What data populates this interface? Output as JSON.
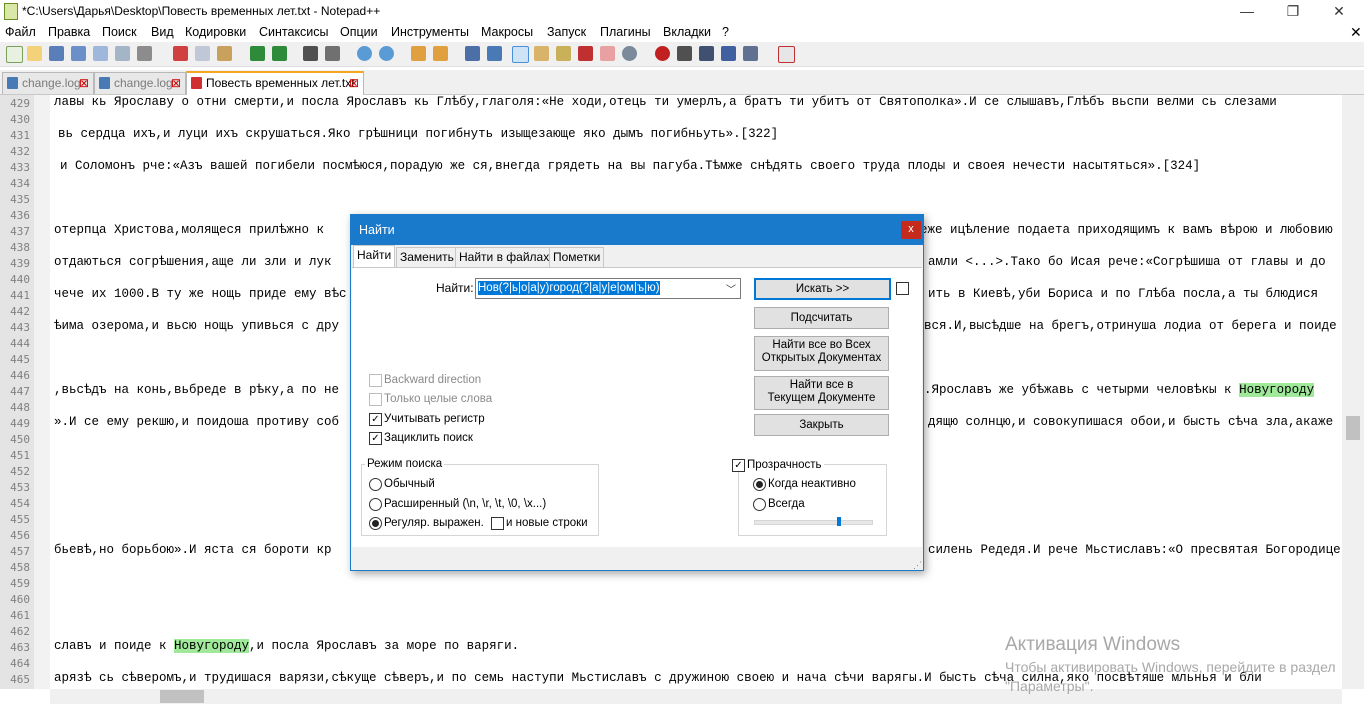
{
  "window": {
    "title": "*C:\\Users\\Дарья\\Desktop\\Повесть временных лет.txt - Notepad++",
    "minimize": "—",
    "maximize": "❐",
    "close": "✕"
  },
  "menu": {
    "items": [
      "Файл",
      "Правка",
      "Поиск",
      "Вид",
      "Кодировки",
      "Синтаксисы",
      "Опции",
      "Инструменты",
      "Макросы",
      "Запуск",
      "Плагины",
      "Вкладки",
      "?"
    ],
    "close": "✕"
  },
  "tabs": [
    {
      "label": "change.log",
      "active": false
    },
    {
      "label": "change.log",
      "active": false
    },
    {
      "label": "Повесть временных лет.txt",
      "active": true
    }
  ],
  "editor": {
    "line_numbers": [
      "429",
      "430",
      "431",
      "432",
      "433",
      "434",
      "435",
      "436",
      "437",
      "438",
      "439",
      "440",
      "441",
      "442",
      "443",
      "444",
      "445",
      "446",
      "447",
      "448",
      "449",
      "450",
      "451",
      "452",
      "453",
      "454",
      "455",
      "456",
      "457",
      "458",
      "459",
      "460",
      "461",
      "462",
      "463",
      "464",
      "465"
    ],
    "lines": [
      {
        "n": "429",
        "text": "лавы кь Ярославу о отни смерти,и посла Ярославъ кь Глѣбу,глаголя:«Не ходи,отець ти умерлъ,а братъ ти убитъ от Святополка».И се слышавъ,Глѣбъ вьспи велми сь слезами"
      },
      {
        "n": "431",
        "text": "вь сердца ихъ,и луци ихъ скрушаться.Яко грѣшници погибнуть изыщезающе яко дымъ погибньуть».[322]"
      },
      {
        "n": "433",
        "text": "и Соломонъ рче:«Азъ вашей погибели посмѣюся,порадую же ся,внегда грядеть на вы пагуба.Тѣмже снѣдять своего труда плоды и своея нечести насытяться».[324]"
      },
      {
        "n": "437",
        "text": "отерпца Христова,молящеся прилѣжно к"
      },
      {
        "n": "437b",
        "text": "еже ицѣление подаета приходящимъ к вамъ вѣрою и любовию"
      },
      {
        "n": "439",
        "text": "отдаються согрѣшения,аще ли зли и лук"
      },
      {
        "n": "439b",
        "text": "амли <...>.Тако бо Исая рече:«Согрѣшиша от главы и до"
      },
      {
        "n": "441",
        "text": "чече их 1000.В ту же нощь приде ему вѣс"
      },
      {
        "n": "441b",
        "text": "ить в Киевѣ,уби Бориса и по Глѣба посла,а ты блюдися"
      },
      {
        "n": "443",
        "text": "ѣима озерома,и вьсю нощь упивься с дру"
      },
      {
        "n": "443b",
        "text": "вся.И,высѣдше на брегъ,отринуша лодиа от берега и поиде"
      },
      {
        "n": "447",
        "text": ",вьсѣдъ на конь,вьбреде в рѣку,а по не"
      },
      {
        "n": "447b",
        "text": ".Ярославъ же убѣжавь с четырми человѣкы к ",
        "hl": "Новугороду"
      },
      {
        "n": "449",
        "text": "».И се ему рекшю,и поидоша противу соб"
      },
      {
        "n": "449b",
        "text": "дящю солнцю,и совокупишася обои,и бысть сѣча зла,акаже"
      },
      {
        "n": "457",
        "text": "бьевѣ,но борьбою».И яста ся бороти кр"
      },
      {
        "n": "457b",
        "text": "силень Редедя.И рече Мьстиславъ:«О пресвятая Богородице"
      },
      {
        "n": "463",
        "text": "славъ и поиде к ",
        "hl": "Новугороду",
        "after": ",и посла Ярославъ за море по варяги."
      },
      {
        "n": "465",
        "text": "арязѣ сь сѣверомъ,и трудишася варязи,сѣкуще сѣверъ,и по семь наступи Мьстиславъ с дружиною своею и нача сѣчи варягы.И бысть сѣча силна,яко посвѣтяше мльнья и бли"
      }
    ]
  },
  "watermark": {
    "title": "Активация Windows",
    "text": "Чтобы активировать Windows, перейдите в раздел \"Параметры\"."
  },
  "dialog": {
    "title": "Найти",
    "close": "x",
    "tabs": [
      "Найти",
      "Заменить",
      "Найти в файлах",
      "Пометки"
    ],
    "find_label": "Найти:",
    "find_value": "Нов(?|ь|о|а|у)город(?|а|у|е|ом|ъ|ю)",
    "buttons": {
      "search": "Искать >>",
      "count": "Подсчитать",
      "find_all_open_1": "Найти все во Всех",
      "find_all_open_2": "Открытых Документах",
      "find_all_current_1": "Найти все в",
      "find_all_current_2": "Текущем Документе",
      "close": "Закрыть"
    },
    "options": {
      "backward": "Backward direction",
      "whole_word": "Только целые слова",
      "match_case": "Учитывать регистр",
      "wrap": "Зациклить поиск"
    },
    "search_mode": {
      "title": "Режим поиска",
      "normal": "Обычный",
      "extended": "Расширенный (\\n, \\r, \\t, \\0, \\x...)",
      "regex": "Регуляр. выражен.",
      "newline": "и новые строки"
    },
    "transparency": {
      "title": "Прозрачность",
      "on_inactive": "Когда неактивно",
      "always": "Всегда",
      "level_percent": 72
    }
  }
}
